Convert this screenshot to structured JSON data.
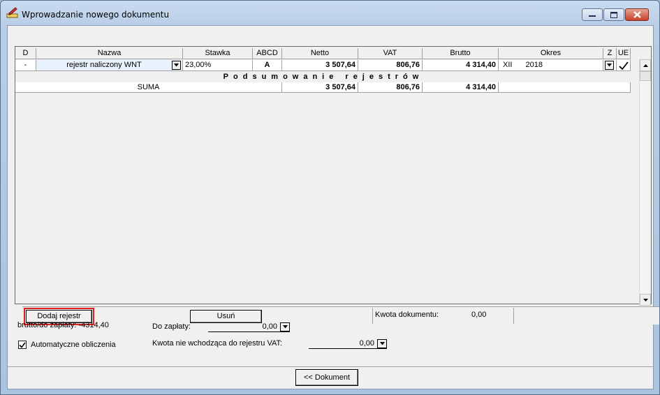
{
  "window": {
    "title": "Wprowadzanie nowego dokumentu"
  },
  "grid": {
    "headers": [
      "D",
      "Nazwa",
      "Stawka",
      "ABCD",
      "Netto",
      "VAT",
      "Brutto",
      "Okres",
      "Z",
      "UE"
    ],
    "row": {
      "d": "-",
      "nazwa": "rejestr naliczony WNT",
      "stawka": "23,00%",
      "abcd": "A",
      "netto": "3 507,64",
      "vat": "806,76",
      "brutto": "4 314,40",
      "okres_month": "XII",
      "okres_year": "2018"
    },
    "summary_heading": "Podsumowanie rejestrów",
    "summary": {
      "label": "SUMA",
      "netto": "3 507,64",
      "vat": "806,76",
      "brutto": "4 314,40"
    }
  },
  "bottom_bar": {
    "add_register": "Dodaj rejestr",
    "remove": "Usuń",
    "doc_amount_label": "Kwota dokumentu:",
    "doc_amount_value": "0,00"
  },
  "form": {
    "brutto_label": "brutto/do zapłaty: -4314,40",
    "auto_calc_label": "Automatyczne obliczenia",
    "auto_calc_checked": true,
    "do_zaplaty_label": "Do zapłaty:",
    "do_zaplaty_value": "0,00",
    "kwota_vat_label": "Kwota nie wchodząca do rejestru VAT:",
    "kwota_vat_value": "0,00"
  },
  "footer": {
    "document_button": "<< Dokument"
  },
  "colors": {
    "highlight": "#e02020",
    "selected_cell": "#e8f1fc"
  },
  "icons": [
    "app-icon",
    "minimize-icon",
    "maximize-icon",
    "close-icon",
    "dropdown-arrow-icon",
    "checkmark-icon",
    "scroll-up-icon",
    "scroll-down-icon"
  ]
}
